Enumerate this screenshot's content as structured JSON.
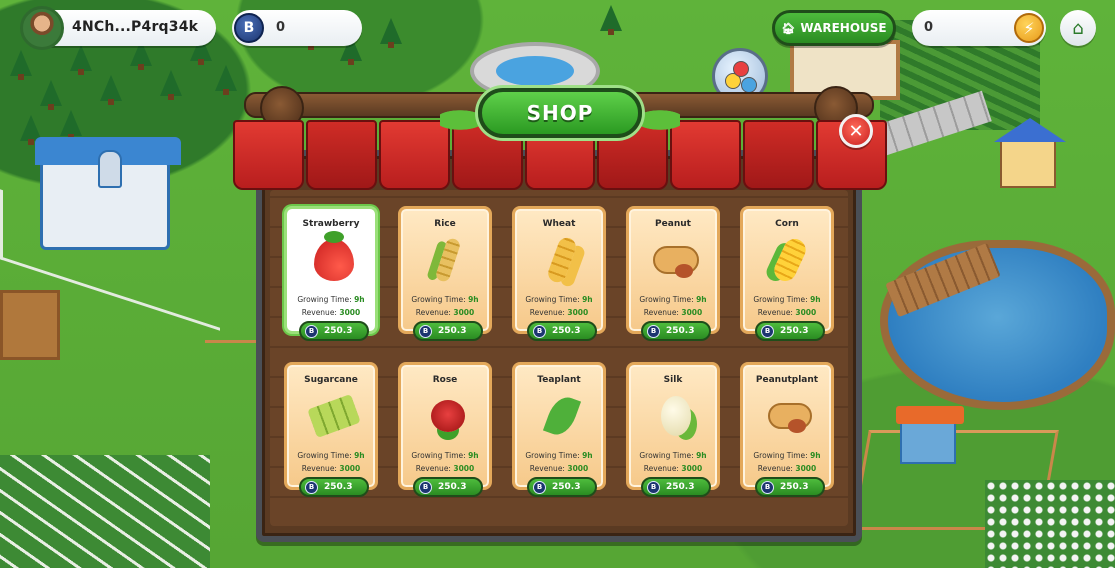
{
  "hud": {
    "player_name": "4NCh...P4rq34k",
    "token_symbol": "B",
    "token_balance": "0",
    "warehouse_label": "WAREHOUSE",
    "energy_balance": "0"
  },
  "shop": {
    "title": "SHOP",
    "growing_time_label": "Growing Time:",
    "revenue_label": "Revenue:",
    "items": [
      {
        "name": "Strawberry",
        "icon": "strawberry-icon",
        "growing_time": "9h",
        "revenue": "3000",
        "price": "250.3",
        "selected": true
      },
      {
        "name": "Rice",
        "icon": "rice-icon",
        "growing_time": "9h",
        "revenue": "3000",
        "price": "250.3"
      },
      {
        "name": "Wheat",
        "icon": "wheat-icon",
        "growing_time": "9h",
        "revenue": "3000",
        "price": "250.3"
      },
      {
        "name": "Peanut",
        "icon": "peanut-icon",
        "growing_time": "9h",
        "revenue": "3000",
        "price": "250.3"
      },
      {
        "name": "Corn",
        "icon": "corn-icon",
        "growing_time": "9h",
        "revenue": "3000",
        "price": "250.3"
      },
      {
        "name": "Sugarcane",
        "icon": "sugarcane-icon",
        "growing_time": "9h",
        "revenue": "3000",
        "price": "250.3"
      },
      {
        "name": "Rose",
        "icon": "rose-icon",
        "growing_time": "9h",
        "revenue": "3000",
        "price": "250.3"
      },
      {
        "name": "Teaplant",
        "icon": "teaplant-icon",
        "growing_time": "9h",
        "revenue": "3000",
        "price": "250.3"
      },
      {
        "name": "Silk",
        "icon": "silk-icon",
        "growing_time": "9h",
        "revenue": "3000",
        "price": "250.3"
      },
      {
        "name": "Peanutplant",
        "icon": "peanutplant-icon",
        "growing_time": "9h",
        "revenue": "3000",
        "price": "250.3"
      }
    ]
  },
  "colors": {
    "accent_green": "#2a8c22",
    "awning_red": "#c81e1e",
    "card_bg": "#f6c98a",
    "wood": "#5a3a22"
  }
}
